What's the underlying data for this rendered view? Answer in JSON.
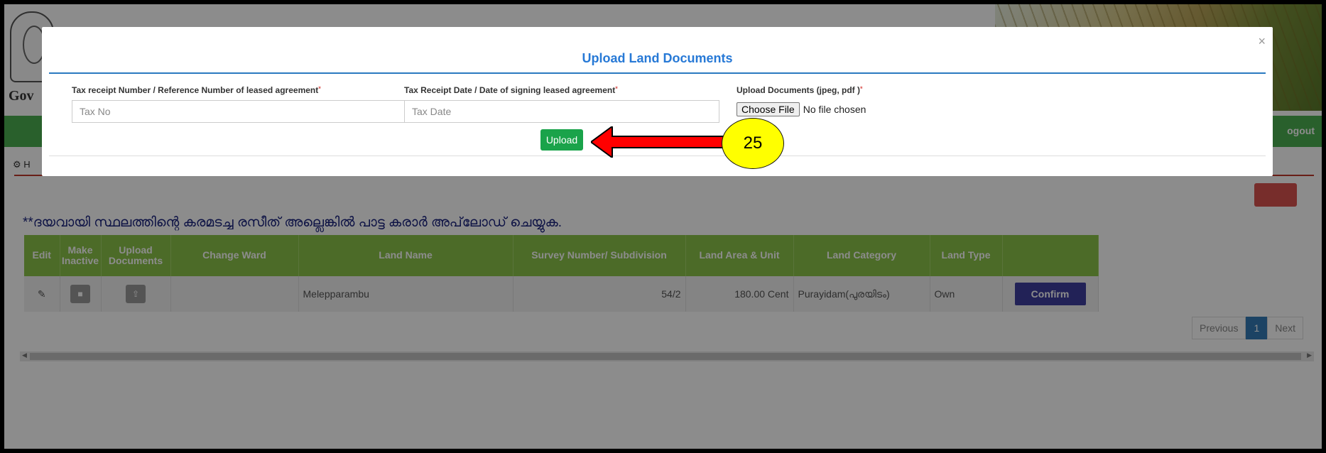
{
  "background": {
    "gov_text": "Gov",
    "logout": "ogout",
    "crumb_icon": "dashboard-icon",
    "crumb_text": "H",
    "note": "**ദയവായി സ്ഥലത്തിന്റെ കരമടച്ച രസീത് അല്ലെങ്കിൽ പാട്ട കരാർ അപ്‌ലോഡ് ചെയ്യുക.",
    "table": {
      "headers": {
        "edit": "Edit",
        "make_inactive": "Make Inactive",
        "upload_documents": "Upload Documents",
        "change_ward": "Change Ward",
        "land_name": "Land Name",
        "survey": "Survey Number/ Subdivision",
        "area": "Land Area & Unit",
        "category": "Land Category",
        "type": "Land Type"
      },
      "row": {
        "land_name": "Melepparambu",
        "survey": "54/2",
        "area": "180.00 Cent",
        "category": "Purayidam(പുരയിടം)",
        "type": "Own",
        "confirm": "Confirm"
      }
    },
    "pager": {
      "previous": "Previous",
      "page": "1",
      "next": "Next"
    }
  },
  "modal": {
    "title": "Upload Land Documents",
    "close": "×",
    "fields": {
      "tax_no_label": "Tax receipt Number / Reference Number of leased agreement",
      "tax_no_placeholder": "Tax No",
      "tax_date_label": "Tax Receipt Date / Date of signing leased agreement",
      "tax_date_placeholder": "Tax Date",
      "docs_label": "Upload Documents (jpeg, pdf )",
      "required_mark": "*",
      "choose_file": "Choose File",
      "no_file": "No file chosen"
    },
    "upload_button": "Upload"
  },
  "annotation": {
    "step": "25",
    "arrow_color": "#ff0000",
    "callout_color": "#ffff00"
  }
}
